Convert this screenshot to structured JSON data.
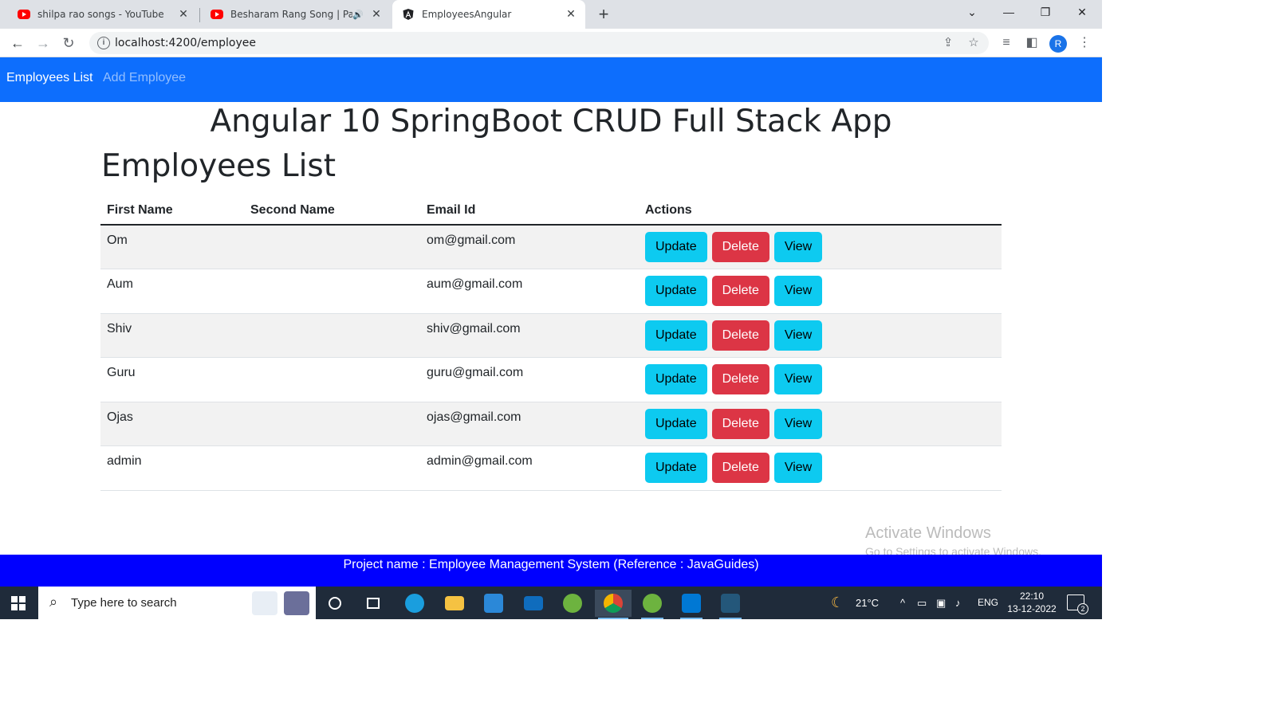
{
  "browser": {
    "tabs": [
      {
        "title": "shilpa rao songs - YouTube",
        "favicon": "youtube-icon"
      },
      {
        "title": "Besharam Rang Song | Patha",
        "favicon": "youtube-icon",
        "audio": true
      },
      {
        "title": "EmployeesAngular",
        "favicon": "angular-icon",
        "active": true
      }
    ],
    "url": "localhost:4200/employee",
    "profile_initial": "R"
  },
  "nav": {
    "items": [
      {
        "label": "Employees List",
        "active": true
      },
      {
        "label": "Add Employee",
        "active": false
      }
    ],
    "color": "#0d6efd"
  },
  "page": {
    "app_title": "Angular 10 SpringBoot CRUD Full Stack App",
    "list_title": "Employees List"
  },
  "table": {
    "headers": [
      "First Name",
      "Second Name",
      "Email Id",
      "Actions"
    ],
    "rows": [
      {
        "first_name": "Om",
        "second_name": "",
        "email": "om@gmail.com"
      },
      {
        "first_name": "Aum",
        "second_name": "",
        "email": "aum@gmail.com"
      },
      {
        "first_name": "Shiv",
        "second_name": "",
        "email": "shiv@gmail.com"
      },
      {
        "first_name": "Guru",
        "second_name": "",
        "email": "guru@gmail.com"
      },
      {
        "first_name": "Ojas",
        "second_name": "",
        "email": "ojas@gmail.com"
      },
      {
        "first_name": "admin",
        "second_name": "",
        "email": "admin@gmail.com"
      }
    ],
    "actions": {
      "update": "Update",
      "delete": "Delete",
      "view": "View"
    }
  },
  "watermark": {
    "line1": "Activate Windows",
    "line2": "Go to Settings to activate Windows."
  },
  "footer": {
    "text": "Project name : Employee Management System (Reference : JavaGuides)",
    "color": "#0000ff"
  },
  "taskbar": {
    "search_placeholder": "Type here to search",
    "weather": "21°C",
    "language": "ENG",
    "time": "22:10",
    "date": "13-12-2022",
    "notifications": "2"
  }
}
